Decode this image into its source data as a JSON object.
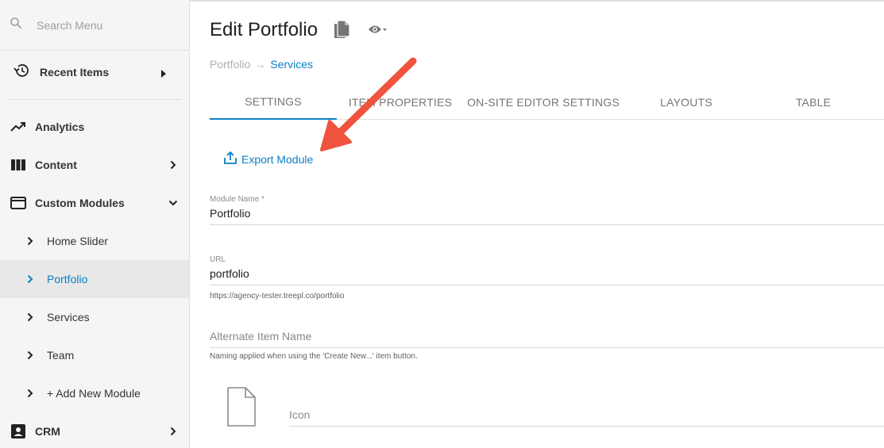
{
  "sidebar": {
    "search_placeholder": "Search Menu",
    "recent_items": "Recent Items",
    "items": [
      {
        "label": "Analytics",
        "icon": "trending-up-icon"
      },
      {
        "label": "Content",
        "icon": "columns-icon"
      },
      {
        "label": "Custom Modules",
        "icon": "window-icon"
      },
      {
        "label": "CRM",
        "icon": "contact-icon"
      }
    ],
    "modules": [
      {
        "label": "Home Slider"
      },
      {
        "label": "Portfolio"
      },
      {
        "label": "Services"
      },
      {
        "label": "Team"
      },
      {
        "label": "+ Add New Module"
      }
    ]
  },
  "main": {
    "title": "Edit Portfolio",
    "breadcrumb": {
      "first": "Portfolio",
      "separator": "→",
      "second": "Services"
    },
    "tabs": [
      {
        "label": "SETTINGS"
      },
      {
        "label": "ITEM PROPERTIES"
      },
      {
        "label": "ON-SITE EDITOR SETTINGS"
      },
      {
        "label": "LAYOUTS"
      },
      {
        "label": "TABLE"
      }
    ],
    "export_label": "Export Module",
    "module_name": {
      "label": "Module Name *",
      "value": "Portfolio"
    },
    "url": {
      "label": "URL",
      "value": "portfolio",
      "hint": "https://agency-tester.treepl.co/portfolio"
    },
    "alt_item_name": {
      "placeholder": "Alternate Item Name",
      "hint": "Naming applied when using the 'Create New...' item button."
    },
    "icon_field": {
      "placeholder": "Icon"
    }
  },
  "colors": {
    "accent": "#0a7fc2",
    "annotation": "#f0533e"
  }
}
